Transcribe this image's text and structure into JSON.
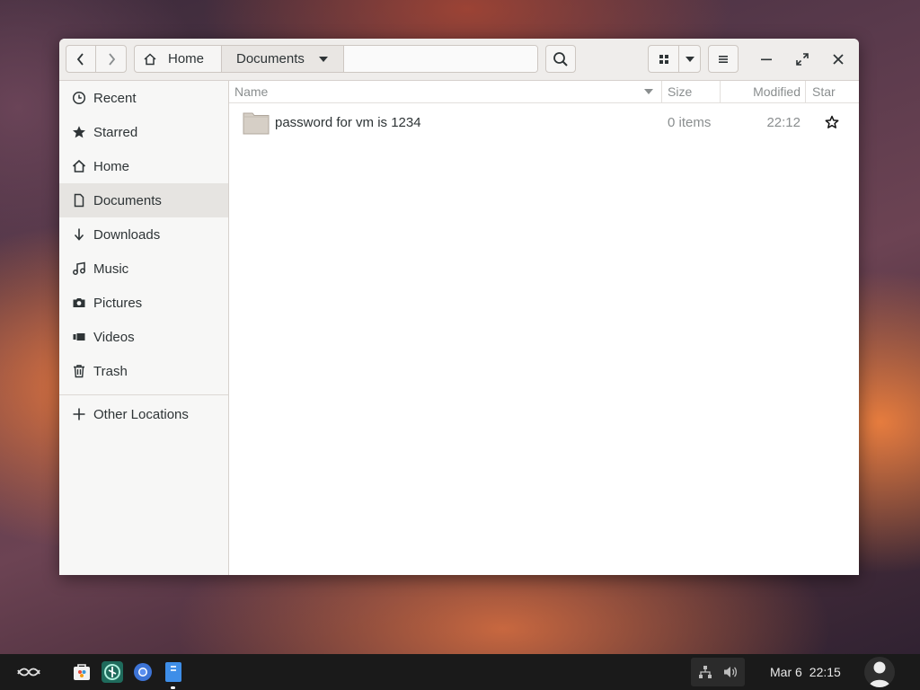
{
  "window": {
    "path": [
      {
        "label": "Home",
        "icon": "home-icon"
      },
      {
        "label": "Documents",
        "icon": "chevron-down-icon"
      }
    ]
  },
  "sidebar": {
    "items": [
      {
        "label": "Recent",
        "icon": "clock-icon"
      },
      {
        "label": "Starred",
        "icon": "star-icon"
      },
      {
        "label": "Home",
        "icon": "home-icon"
      },
      {
        "label": "Documents",
        "icon": "document-icon",
        "selected": true
      },
      {
        "label": "Downloads",
        "icon": "download-icon"
      },
      {
        "label": "Music",
        "icon": "music-icon"
      },
      {
        "label": "Pictures",
        "icon": "camera-icon"
      },
      {
        "label": "Videos",
        "icon": "video-icon"
      },
      {
        "label": "Trash",
        "icon": "trash-icon"
      }
    ],
    "other": {
      "label": "Other Locations",
      "icon": "plus-icon"
    }
  },
  "columns": {
    "name": "Name",
    "size": "Size",
    "modified": "Modified",
    "star": "Star"
  },
  "files": [
    {
      "name": "password for vm is 1234",
      "size": "0 items",
      "modified": "22:12",
      "starred": false,
      "icon": "folder-icon"
    }
  ],
  "taskbar": {
    "date": "Mar 6",
    "time": "22:15"
  },
  "colors": {
    "headerbar": "#efedeb",
    "sidebar": "#f7f7f6",
    "selected": "#e6e4e1",
    "taskbar": "#1a1a1a"
  }
}
